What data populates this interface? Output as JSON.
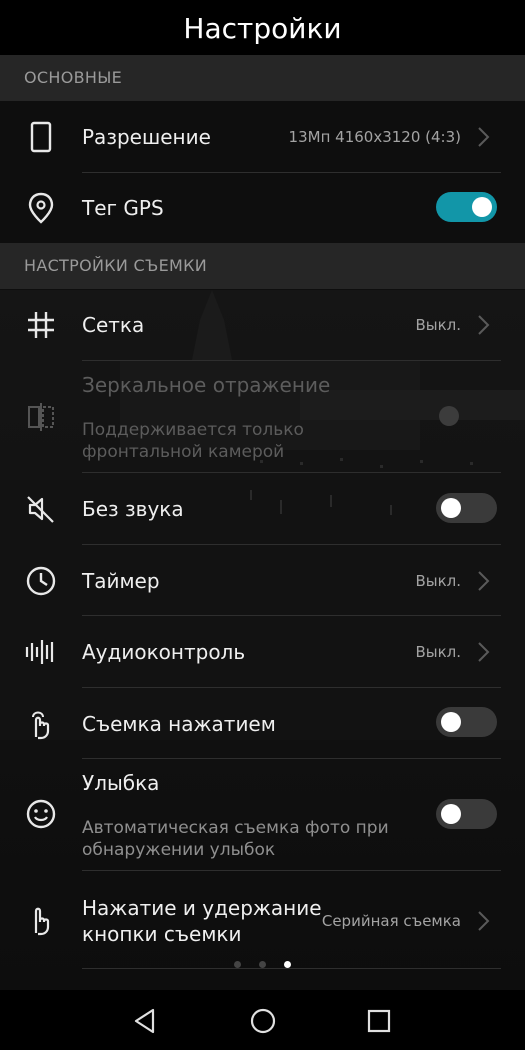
{
  "header": {
    "title": "Настройки"
  },
  "sections": {
    "basic": "ОСНОВНЫЕ",
    "shooting": "НАСТРОЙКИ СЪЕМКИ"
  },
  "rows": {
    "resolution": {
      "label": "Разрешение",
      "value": "13Мп 4160x3120 (4:3)",
      "icon": "phone-outline-icon"
    },
    "gps": {
      "label": "Тег GPS",
      "on": true,
      "icon": "location-pin-icon"
    },
    "grid": {
      "label": "Сетка",
      "value": "Выкл.",
      "icon": "grid-icon"
    },
    "mirror": {
      "label": "Зеркальное отражение",
      "sub1": "Поддерживается только",
      "sub2": "фронтальной камерой",
      "icon": "mirror-icon",
      "enabled": false
    },
    "mute": {
      "label": "Без звука",
      "on": false,
      "icon": "mute-icon"
    },
    "timer": {
      "label": "Таймер",
      "value": "Выкл.",
      "icon": "clock-icon"
    },
    "audio": {
      "label": "Аудиоконтроль",
      "value": "Выкл.",
      "icon": "audio-wave-icon"
    },
    "touch": {
      "label": "Съемка нажатием",
      "on": false,
      "icon": "touch-icon"
    },
    "smile": {
      "label": "Улыбка",
      "sub1": "Автоматическая съемка фото при",
      "sub2": "обнаружении улыбок",
      "on": false,
      "icon": "smile-icon"
    },
    "hold": {
      "label1": "Нажатие и удержание",
      "label2": "кнопки съемки",
      "value": "Серийная съемка",
      "icon": "touch-hold-icon"
    }
  },
  "pager": {
    "count": 3,
    "active_index": 2
  },
  "colors": {
    "accent": "#1296a8",
    "section_bg": "#262626",
    "background": "#0e0e0e"
  }
}
